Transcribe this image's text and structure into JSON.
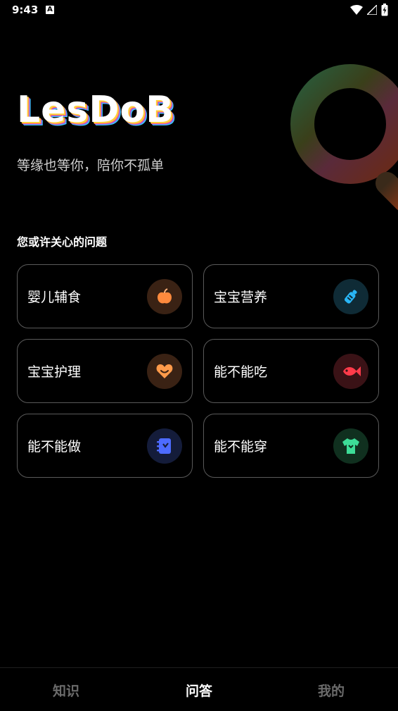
{
  "status_bar": {
    "time": "9:43",
    "notification_icon": "A"
  },
  "hero": {
    "logo": "LesDoB",
    "slogan": "等缘也等你，陪你不孤单"
  },
  "section": {
    "title": "您或许关心的问题"
  },
  "cards": [
    {
      "label": "婴儿辅食",
      "icon": "apple-icon",
      "color": "#ff8a3d",
      "bg": "#3a2214"
    },
    {
      "label": "宝宝营养",
      "icon": "baby-bottle-icon",
      "color": "#29b6f6",
      "bg": "#0f2b36"
    },
    {
      "label": "宝宝护理",
      "icon": "heart-icon",
      "color": "#ff9a4a",
      "bg": "#3a2214"
    },
    {
      "label": "能不能吃",
      "icon": "fish-icon",
      "color": "#ff3b4a",
      "bg": "#3a1216"
    },
    {
      "label": "能不能做",
      "icon": "notebook-icon",
      "color": "#4d6bff",
      "bg": "#141c3a"
    },
    {
      "label": "能不能穿",
      "icon": "tshirt-icon",
      "color": "#3ddc97",
      "bg": "#10301f"
    }
  ],
  "nav": {
    "tabs": [
      {
        "label": "知识",
        "active": false
      },
      {
        "label": "问答",
        "active": true
      },
      {
        "label": "我的",
        "active": false
      }
    ]
  }
}
